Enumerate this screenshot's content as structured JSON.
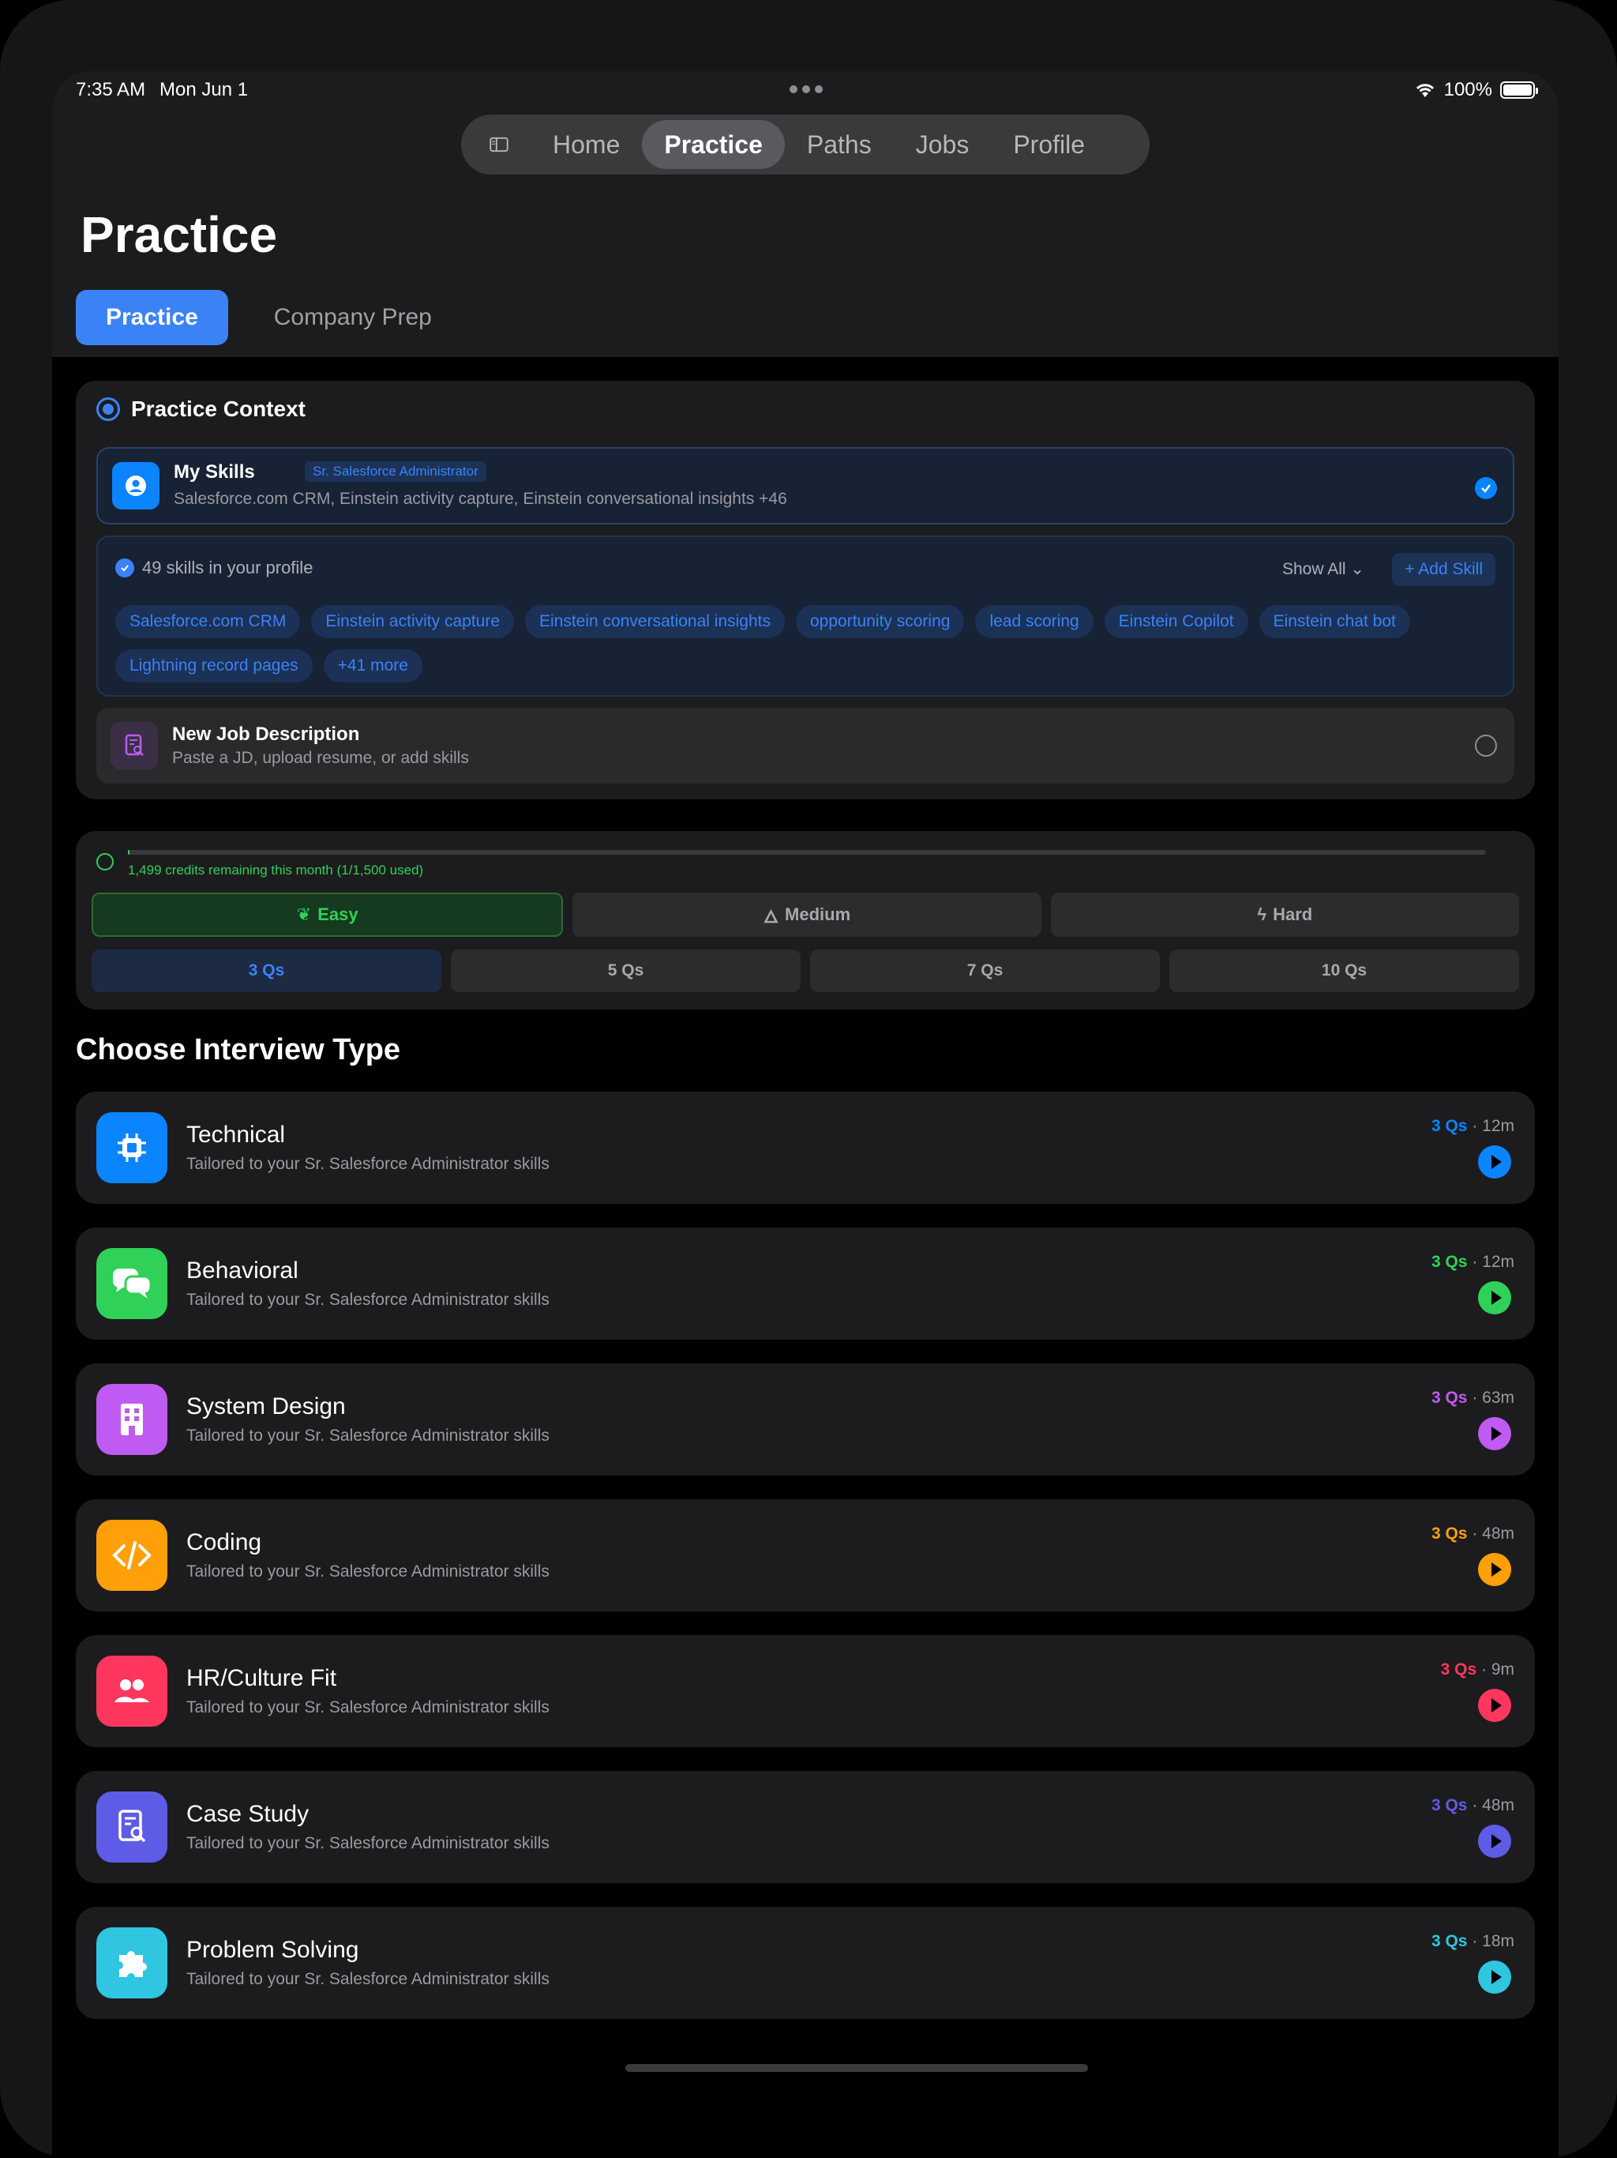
{
  "status_bar": {
    "time": "7:35 AM",
    "date": "Mon Jun 1",
    "battery": "100%"
  },
  "nav": {
    "tabs": [
      "Home",
      "Practice",
      "Paths",
      "Jobs",
      "Profile"
    ],
    "active": "Practice"
  },
  "page_title": "Practice",
  "segments": {
    "items": [
      "Practice",
      "Company Prep"
    ],
    "active": "Practice"
  },
  "practice_context": {
    "title": "Practice Context",
    "my_skills": {
      "title": "My Skills",
      "role_badge": "Sr. Salesforce Administrator",
      "summary": "Salesforce.com CRM, Einstein activity capture, Einstein conversational insights +46"
    },
    "profile": {
      "count_text": "49 skills in your profile",
      "show_all": "Show All",
      "add_skill": "+ Add Skill",
      "chips": [
        "Salesforce.com CRM",
        "Einstein activity capture",
        "Einstein conversational insights",
        "opportunity scoring",
        "lead scoring",
        "Einstein Copilot",
        "Einstein chat bot",
        "Lightning record pages",
        "+41 more"
      ]
    },
    "new_jd": {
      "title": "New Job Description",
      "subtitle": "Paste a JD, upload resume, or add skills"
    }
  },
  "credits": {
    "text": "1,499 credits remaining this month (1/1,500 used)",
    "used_fraction": 0.00067
  },
  "difficulty": {
    "items": [
      "Easy",
      "Medium",
      "Hard"
    ],
    "active": "Easy"
  },
  "question_counts": {
    "items": [
      "3 Qs",
      "5 Qs",
      "7 Qs",
      "10 Qs"
    ],
    "active": "3 Qs"
  },
  "choose_title": "Choose Interview Type",
  "interview_types": [
    {
      "name": "Technical",
      "subtitle": "Tailored to your Sr. Salesforce Administrator skills",
      "qs": "3 Qs",
      "duration": "· 12m",
      "color": "#0a84ff",
      "icon": "chip-icon"
    },
    {
      "name": "Behavioral",
      "subtitle": "Tailored to your Sr. Salesforce Administrator skills",
      "qs": "3 Qs",
      "duration": "· 12m",
      "color": "#30d158",
      "icon": "chat-bubbles-icon"
    },
    {
      "name": "System Design",
      "subtitle": "Tailored to your Sr. Salesforce Administrator skills",
      "qs": "3 Qs",
      "duration": "· 63m",
      "color": "#bf5af2",
      "icon": "building-icon"
    },
    {
      "name": "Coding",
      "subtitle": "Tailored to your Sr. Salesforce Administrator skills",
      "qs": "3 Qs",
      "duration": "· 48m",
      "color": "#ff9f0a",
      "icon": "code-icon"
    },
    {
      "name": "HR/Culture Fit",
      "subtitle": "Tailored to your Sr. Salesforce Administrator skills",
      "qs": "3 Qs",
      "duration": "· 9m",
      "color": "#ff375f",
      "icon": "people-icon"
    },
    {
      "name": "Case Study",
      "subtitle": "Tailored to your Sr. Salesforce Administrator skills",
      "qs": "3 Qs",
      "duration": "· 48m",
      "color": "#5e5ce6",
      "icon": "document-search-icon"
    },
    {
      "name": "Problem Solving",
      "subtitle": "Tailored to your Sr. Salesforce Administrator skills",
      "qs": "3 Qs",
      "duration": "· 18m",
      "color": "#30c5e0",
      "icon": "puzzle-icon"
    }
  ]
}
